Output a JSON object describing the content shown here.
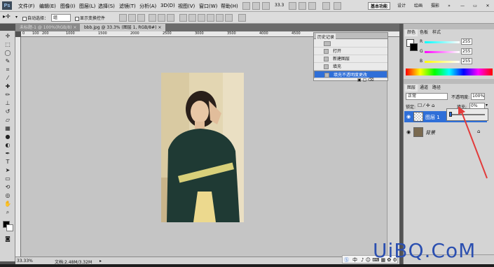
{
  "app": {
    "logo": "Ps",
    "menu": [
      "文件(F)",
      "编辑(E)",
      "图像(I)",
      "图层(L)",
      "选择(S)",
      "滤镜(T)",
      "分析(A)",
      "3D(D)",
      "视图(V)",
      "窗口(W)",
      "帮助(H)"
    ],
    "zoom": "33.3"
  },
  "workspaces": {
    "active": "基本功能",
    "items": [
      "设计",
      "绘画",
      "摄影"
    ]
  },
  "options": {
    "auto_select_label": "自动选择：",
    "auto_select_value": "组",
    "show_transform_label": "显示变换控件"
  },
  "tabs": [
    {
      "label": "未标题-1 @ 100%(RGB/8) ×"
    },
    {
      "label": "bbb.jpg @ 33.3% (图层 1, RGB/8#) ×"
    }
  ],
  "ruler_ticks": [
    "0",
    "100",
    "200",
    "1000",
    "1500",
    "2000",
    "2500",
    "3000",
    "3500",
    "4000",
    "4500"
  ],
  "history": {
    "title": "历史记录",
    "items": [
      {
        "label": "打开"
      },
      {
        "label": "新建图层"
      },
      {
        "label": "填充"
      },
      {
        "label": "填充不透明度更改"
      }
    ]
  },
  "color_panel": {
    "tabs": [
      "颜色",
      "色板",
      "样式"
    ],
    "channels": [
      {
        "name": "R",
        "value": "255"
      },
      {
        "name": "G",
        "value": "255"
      },
      {
        "name": "B",
        "value": "255"
      }
    ]
  },
  "layers_panel": {
    "tabs": [
      "图层",
      "通道",
      "路径"
    ],
    "blend_mode": "正常",
    "opacity_label": "不透明度:",
    "opacity_value": "100%",
    "lock_label": "锁定:",
    "fill_label": "填充:",
    "fill_value": "0%",
    "layers": [
      {
        "name": "图层 1",
        "selected": true
      },
      {
        "name": "背景",
        "selected": false
      }
    ]
  },
  "status": {
    "zoom": "33.33%",
    "doc": "文档:2.48M/3.32M"
  },
  "ime": {
    "label": "中"
  },
  "watermark": {
    "text": "UiBQ.CoM"
  },
  "colors": {
    "accent": "#2f6fd8",
    "arrow": "#e23b3b"
  }
}
